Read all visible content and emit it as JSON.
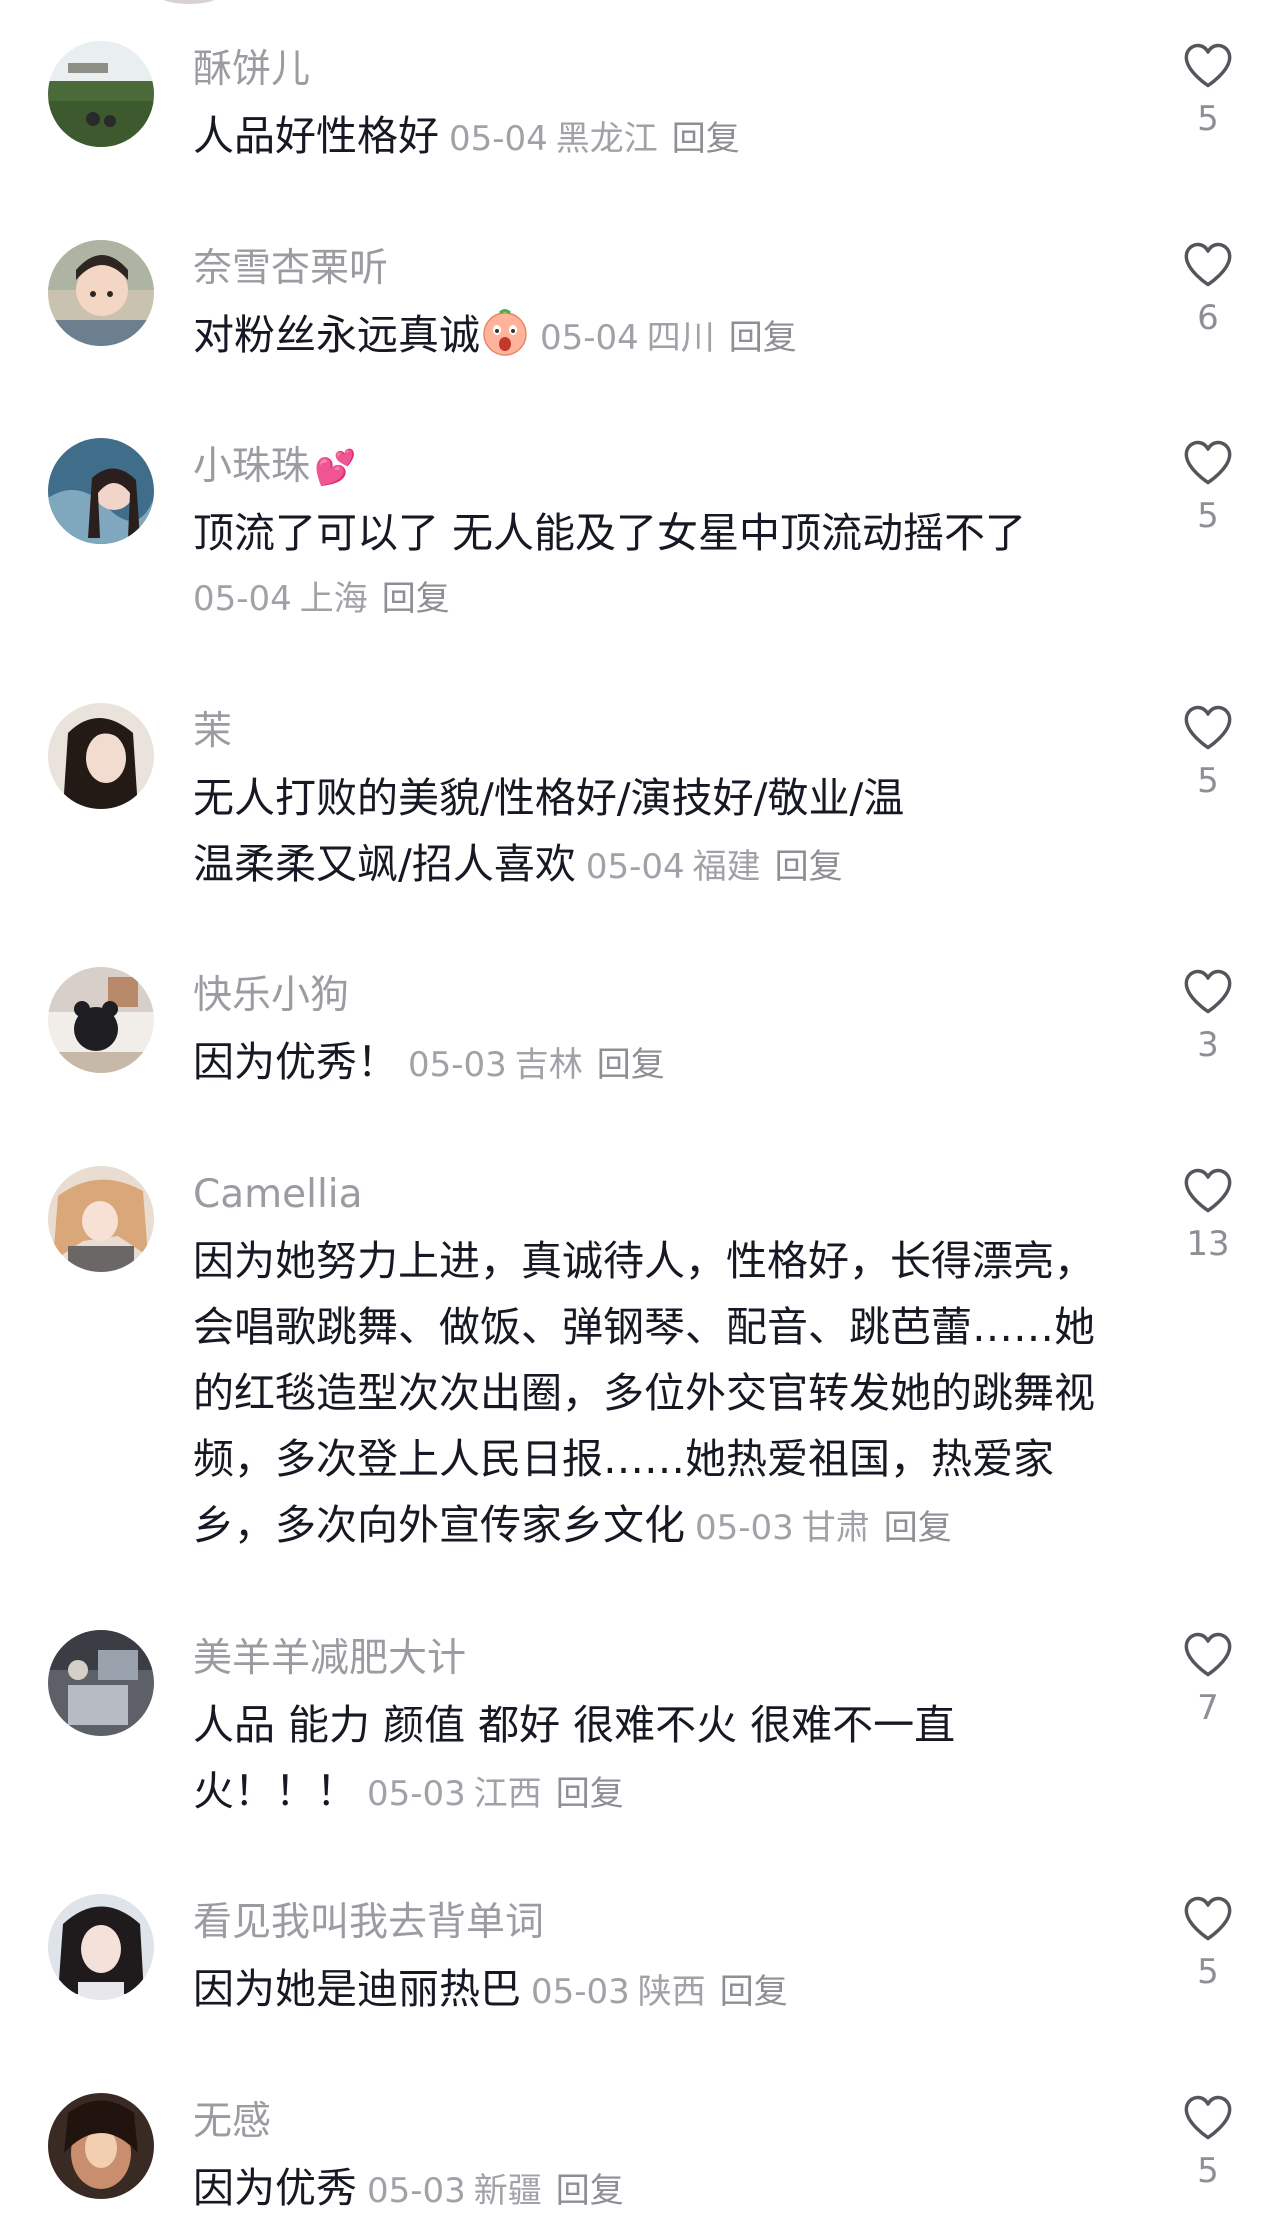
{
  "comments": [
    {
      "username": "酥饼儿",
      "text": "人品好性格好",
      "date": "05-04",
      "location": "黑龙江",
      "reply": "回复",
      "likes": "5"
    },
    {
      "username": "奈雪杏栗听",
      "text": "对粉丝永远真诚",
      "date": "05-04",
      "location": "四川",
      "reply": "回复",
      "likes": "6"
    },
    {
      "username": "小珠珠",
      "text": "顶流了可以了 无人能及了女星中顶流动摇不了",
      "date": "05-04",
      "location": "上海",
      "reply": "回复",
      "likes": "5"
    },
    {
      "username": "茉",
      "text": "无人打败的美貌/性格好/演技好/敬业/温温柔柔又飒/招人喜欢",
      "date": "05-04",
      "location": "福建",
      "reply": "回复",
      "likes": "5"
    },
    {
      "username": "快乐小狗",
      "text": "因为优秀！",
      "date": "05-03",
      "location": "吉林",
      "reply": "回复",
      "likes": "3"
    },
    {
      "username": "Camellia",
      "text": "因为她努力上进，真诚待人，性格好，长得漂亮，会唱歌跳舞、做饭、弹钢琴、配音、跳芭蕾……她的红毯造型次次出圈，多位外交官转发她的跳舞视频，多次登上人民日报……她热爱祖国，热爱家乡，多次向外宣传家乡文化",
      "date": "05-03",
      "location": "甘肃",
      "reply": "回复",
      "likes": "13"
    },
    {
      "username": "美羊羊减肥大计",
      "text": "人品 能力 颜值 都好 很难不火 很难不一直火！！！",
      "date": "05-03",
      "location": "江西",
      "reply": "回复",
      "likes": "7"
    },
    {
      "username": "看见我叫我去背单词",
      "text": "因为她是迪丽热巴",
      "date": "05-03",
      "location": "陕西",
      "reply": "回复",
      "likes": "5"
    },
    {
      "username": "无感",
      "text": "因为优秀",
      "date": "05-03",
      "location": "新疆",
      "reply": "回复",
      "likes": "5"
    }
  ],
  "icons": {
    "like": "heart-outline-icon",
    "emoji_face": "screaming-face-emoji",
    "emoji_hearts": "two-hearts-emoji"
  },
  "colors": {
    "text": "#161823",
    "username": "#9b9ca1",
    "meta": "#a1a2a7",
    "heart_stroke": "#55565c",
    "emoji_pink": "#ff4fa0"
  }
}
